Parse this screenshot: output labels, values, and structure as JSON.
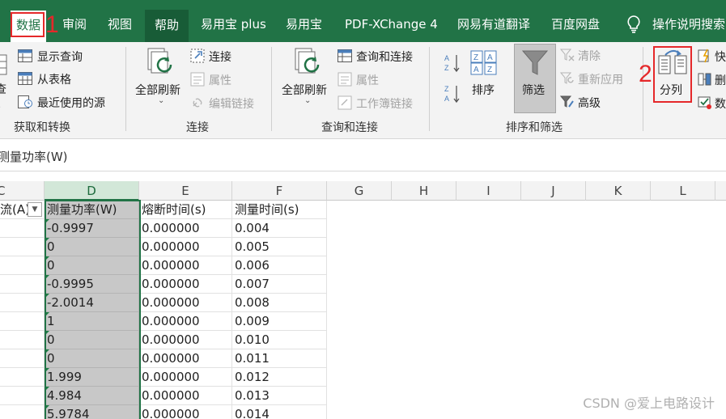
{
  "tabs": [
    {
      "label": "数据",
      "name": "tab-data",
      "active": true
    },
    {
      "label": "审阅",
      "name": "tab-review"
    },
    {
      "label": "视图",
      "name": "tab-view"
    },
    {
      "label": "帮助",
      "name": "tab-help"
    },
    {
      "label": "易用宝 plus",
      "name": "tab-yiyongbao-plus"
    },
    {
      "label": "易用宝",
      "name": "tab-yiyongbao"
    },
    {
      "label": "PDF-XChange 4",
      "name": "tab-pdf-xchange"
    },
    {
      "label": "网易有道翻译",
      "name": "tab-youdao"
    },
    {
      "label": "百度网盘",
      "name": "tab-baidu-netdisk"
    }
  ],
  "search_label": "操作说明搜索",
  "annotations": {
    "step1": "1",
    "step2": "2"
  },
  "ribbon": {
    "get_transform": {
      "group_label": "获取和转换",
      "partial_label": "查",
      "show_query": "显示查询",
      "from_table": "从表格",
      "recent_sources": "最近使用的源"
    },
    "connections": {
      "group_label": "连接",
      "refresh_all": "全部刷新",
      "connections": "连接",
      "properties": "属性",
      "edit_links": "编辑链接"
    },
    "queries_connections": {
      "group_label": "查询和连接",
      "refresh_all": "全部刷新",
      "queries_and_connections": "查询和连接",
      "properties": "属性",
      "workbook_links": "工作簿链接"
    },
    "sort_filter": {
      "group_label": "排序和筛选",
      "sort": "排序",
      "filter": "筛选",
      "clear": "清除",
      "reapply": "重新应用",
      "advanced": "高级"
    },
    "data_tools": {
      "text_to_columns": "分列",
      "flash_fill_partial": "快",
      "remove_dup_partial": "删",
      "validation_partial": "数"
    }
  },
  "formula_bar": {
    "content": "测量功率(W)"
  },
  "columns": [
    "C",
    "D",
    "E",
    "F",
    "G",
    "H",
    "I",
    "J",
    "K",
    "L"
  ],
  "header_row": {
    "c": "流(A)",
    "d": "测量功率(W)",
    "e": "熔断时间(s)",
    "f": "测量时间(s)"
  },
  "rows": [
    {
      "d": "-0.9997",
      "e": "0.000000",
      "f": "0.004"
    },
    {
      "d": "0",
      "e": "0.000000",
      "f": "0.005"
    },
    {
      "d": "0",
      "e": "0.000000",
      "f": "0.006"
    },
    {
      "d": "-0.9995",
      "e": "0.000000",
      "f": "0.007"
    },
    {
      "d": "-2.0014",
      "e": "0.000000",
      "f": "0.008"
    },
    {
      "d": "1",
      "e": "0.000000",
      "f": "0.009"
    },
    {
      "d": "0",
      "e": "0.000000",
      "f": "0.010"
    },
    {
      "d": "0",
      "e": "0.000000",
      "f": "0.011"
    },
    {
      "d": "1.999",
      "e": "0.000000",
      "f": "0.012"
    },
    {
      "d": "4.984",
      "e": "0.000000",
      "f": "0.013"
    },
    {
      "d": "5.9784",
      "e": "0.000000",
      "f": "0.014"
    }
  ],
  "watermark": "CSDN @爱上电路设计",
  "colors": {
    "excel_green": "#217346",
    "annotation_red": "#e5282a",
    "selection_gray": "#c8c8c8"
  }
}
